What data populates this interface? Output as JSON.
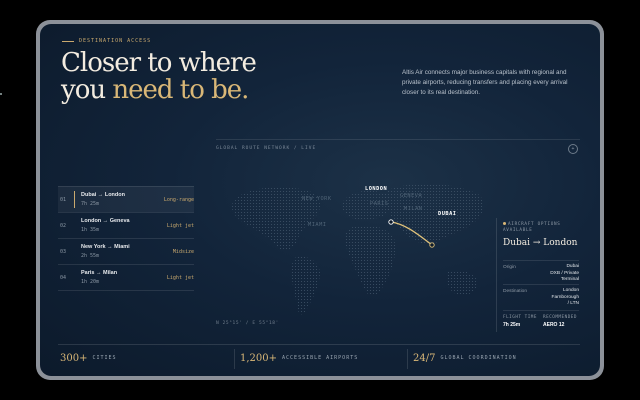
{
  "hero": {
    "eyebrow": "DESTINATION ACCESS",
    "headline_line1": "Closer to where",
    "headline_line2_plain": "you ",
    "headline_line2_accent": "need to be.",
    "intro": "Altis Air connects major business capitals with regional and private airports, reducing transfers and placing every arrival closer to its real destination."
  },
  "map": {
    "title": "GLOBAL ROUTE NETWORK / LIVE",
    "coords": "N 25°15' / E 55°18'",
    "cities": [
      {
        "name": "LONDON",
        "highlight": true
      },
      {
        "name": "GENEVA",
        "highlight": false
      },
      {
        "name": "PARIS",
        "highlight": false
      },
      {
        "name": "MILAN",
        "highlight": false
      },
      {
        "name": "DUBAI",
        "highlight": true
      },
      {
        "name": "NEW YORK",
        "highlight": false
      },
      {
        "name": "MIAMI",
        "highlight": false
      }
    ],
    "accent_color": "#e0c27a"
  },
  "routes": [
    {
      "num": "01",
      "name": "Dubai → London",
      "time": "7h 25m",
      "type": "Long-range",
      "active": true
    },
    {
      "num": "02",
      "name": "London → Geneva",
      "time": "1h 35m",
      "type": "Light jet",
      "active": false
    },
    {
      "num": "03",
      "name": "New York → Miami",
      "time": "2h 55m",
      "type": "Midsize",
      "active": false
    },
    {
      "num": "04",
      "name": "Paris → Milan",
      "time": "1h 20m",
      "type": "Light jet",
      "active": false
    }
  ],
  "panel": {
    "header": "AIRCRAFT OPTIONS AVAILABLE",
    "title": "Dubai → London",
    "origin_label": "Origin",
    "origin_value_1": "Dubai",
    "origin_value_2": "DXB / Private",
    "origin_value_3": "Terminal",
    "destination_label": "Destination",
    "destination_value_1": "London",
    "destination_value_2": "Farnborough",
    "destination_value_3": "/ LTN",
    "flight_time_label": "FLIGHT TIME",
    "flight_time_value": "7h 25m",
    "recommended_label": "RECOMMENDED",
    "recommended_value": "AERO 12"
  },
  "stats": [
    {
      "value": "300",
      "suffix": "+",
      "label": "CITIES"
    },
    {
      "value": "1,200",
      "suffix": "+",
      "label": "ACCESSIBLE AIRPORTS"
    },
    {
      "value": "24/7",
      "suffix": "",
      "label": "GLOBAL COORDINATION"
    }
  ]
}
